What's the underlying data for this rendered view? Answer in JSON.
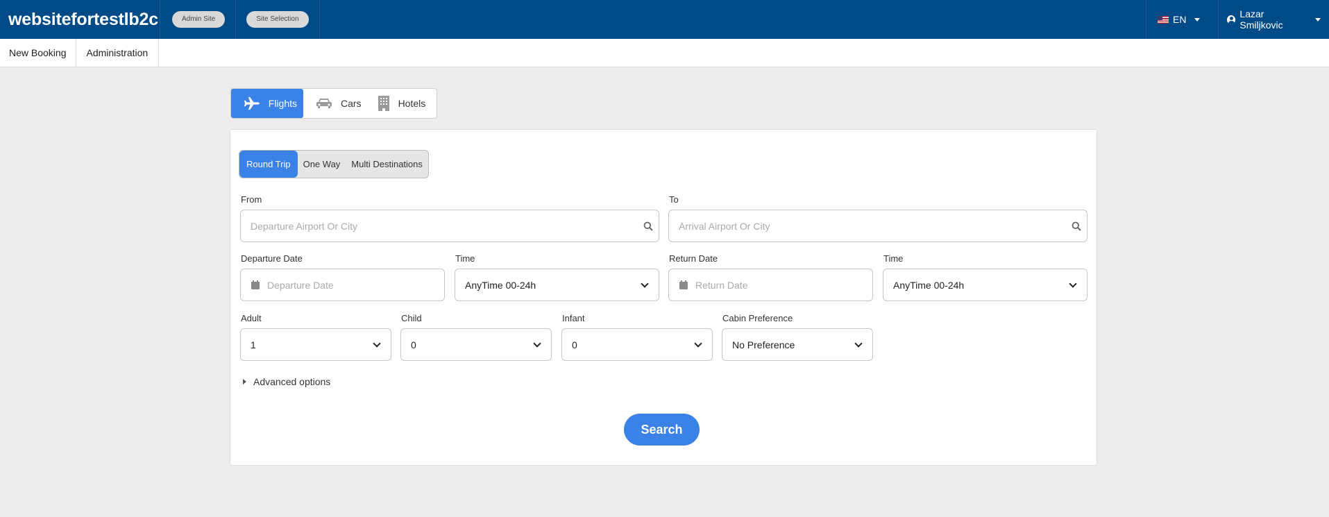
{
  "header": {
    "brand": "websitefortestlb2c",
    "admin_site": "Admin Site",
    "site_selection": "Site Selection",
    "language": "EN",
    "user_name": "Lazar Smiljkovic"
  },
  "nav": {
    "new_booking": "New Booking",
    "administration": "Administration"
  },
  "product_tabs": {
    "flights": "Flights",
    "cars": "Cars",
    "hotels": "Hotels",
    "active": "Flights"
  },
  "trip_types": {
    "round_trip": "Round Trip",
    "one_way": "One Way",
    "multi": "Multi Destinations",
    "active": "Round Trip"
  },
  "form": {
    "from_label": "From",
    "from_placeholder": "Departure Airport Or City",
    "to_label": "To",
    "to_placeholder": "Arrival Airport Or City",
    "departure_date_label": "Departure Date",
    "departure_date_placeholder": "Departure Date",
    "departure_time_label": "Time",
    "departure_time_value": "AnyTime 00-24h",
    "return_date_label": "Return Date",
    "return_date_placeholder": "Return Date",
    "return_time_label": "Time",
    "return_time_value": "AnyTime 00-24h",
    "adult_label": "Adult",
    "adult_value": "1",
    "child_label": "Child",
    "child_value": "0",
    "infant_label": "Infant",
    "infant_value": "0",
    "cabin_label": "Cabin Preference",
    "cabin_value": "No Preference",
    "advanced_options": "Advanced options",
    "search_button": "Search"
  },
  "colors": {
    "header_bg": "#004a87",
    "accent": "#3b82e6",
    "page_bg": "#ececec"
  }
}
